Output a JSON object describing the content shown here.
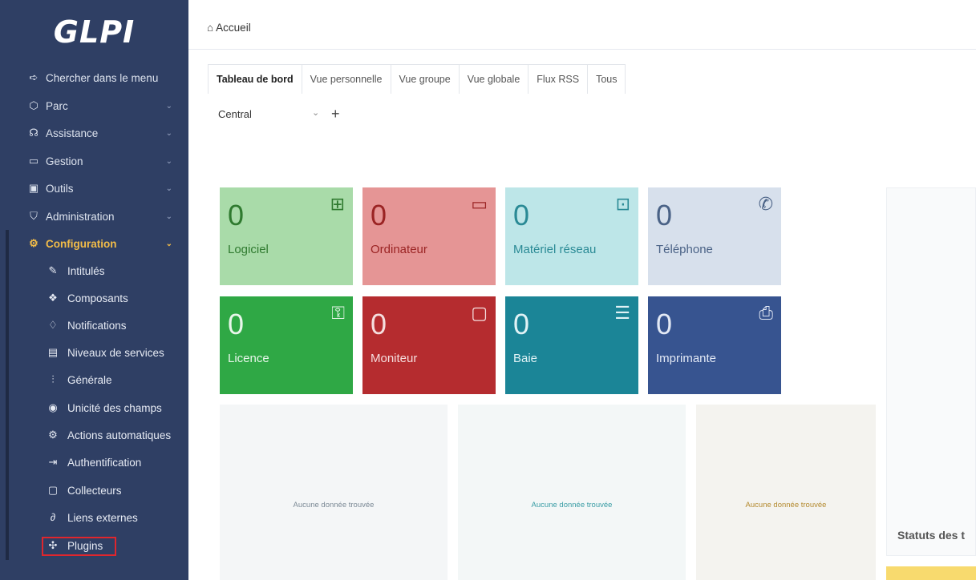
{
  "app": {
    "logo": "GLPI"
  },
  "breadcrumb": {
    "icon": "home-icon",
    "label": "Accueil"
  },
  "sidebar": {
    "search_label": "Chercher dans le menu",
    "items": [
      {
        "label": "Parc",
        "icon": "cube-icon"
      },
      {
        "label": "Assistance",
        "icon": "headset-icon"
      },
      {
        "label": "Gestion",
        "icon": "wallet-icon"
      },
      {
        "label": "Outils",
        "icon": "briefcase-icon"
      },
      {
        "label": "Administration",
        "icon": "shield-icon"
      },
      {
        "label": "Configuration",
        "icon": "gear-icon",
        "active": true
      }
    ],
    "subitems": [
      {
        "label": "Intitulés",
        "icon": "edit-icon"
      },
      {
        "label": "Composants",
        "icon": "components-icon"
      },
      {
        "label": "Notifications",
        "icon": "bell-icon"
      },
      {
        "label": "Niveaux de services",
        "icon": "clipboard-check-icon"
      },
      {
        "label": "Générale",
        "icon": "adjustments-icon"
      },
      {
        "label": "Unicité des champs",
        "icon": "fingerprint-icon"
      },
      {
        "label": "Actions automatiques",
        "icon": "settings-automation-icon"
      },
      {
        "label": "Authentification",
        "icon": "login-icon"
      },
      {
        "label": "Collecteurs",
        "icon": "inbox-icon"
      },
      {
        "label": "Liens externes",
        "icon": "link-icon"
      },
      {
        "label": "Plugins",
        "icon": "puzzle-icon"
      }
    ]
  },
  "tabs": [
    "Tableau de bord",
    "Vue personnelle",
    "Vue groupe",
    "Vue globale",
    "Flux RSS",
    "Tous"
  ],
  "dashboard_select": {
    "value": "Central",
    "add": "+"
  },
  "cards": [
    {
      "value": "0",
      "label": "Logiciel",
      "icon": "apps-icon",
      "bg": "#a9dba9",
      "fg": "#2f7a2f"
    },
    {
      "value": "0",
      "label": "Ordinateur",
      "icon": "laptop-icon",
      "bg": "#e59595",
      "fg": "#9b2424"
    },
    {
      "value": "0",
      "label": "Matériel réseau",
      "icon": "network-icon",
      "bg": "#bde6e8",
      "fg": "#2a8a95"
    },
    {
      "value": "0",
      "label": "Téléphone",
      "icon": "phone-icon",
      "bg": "#d7e0ec",
      "fg": "#4a6286"
    },
    {
      "value": "0",
      "label": "Licence",
      "icon": "key-icon",
      "bg": "#2fa845",
      "fg": "#e8f6ea"
    },
    {
      "value": "0",
      "label": "Moniteur",
      "icon": "monitor-icon",
      "bg": "#b52c2f",
      "fg": "#f5dede"
    },
    {
      "value": "0",
      "label": "Baie",
      "icon": "server-icon",
      "bg": "#1b8597",
      "fg": "#e0f2f5"
    },
    {
      "value": "0",
      "label": "Imprimante",
      "icon": "printer-icon",
      "bg": "#375490",
      "fg": "#e3e9f5"
    }
  ],
  "panels": [
    {
      "message": "Aucune donnée trouvée",
      "bg": "#f4f6f7",
      "fg": "#7c8a96"
    },
    {
      "message": "Aucune donnée trouvée",
      "bg": "#f3f7f7",
      "fg": "#3a9da5"
    },
    {
      "message": "Aucune donnée trouvée",
      "bg": "#f4f3ef",
      "fg": "#b48a2f"
    }
  ],
  "right_panel": {
    "title": "Statuts des t"
  }
}
